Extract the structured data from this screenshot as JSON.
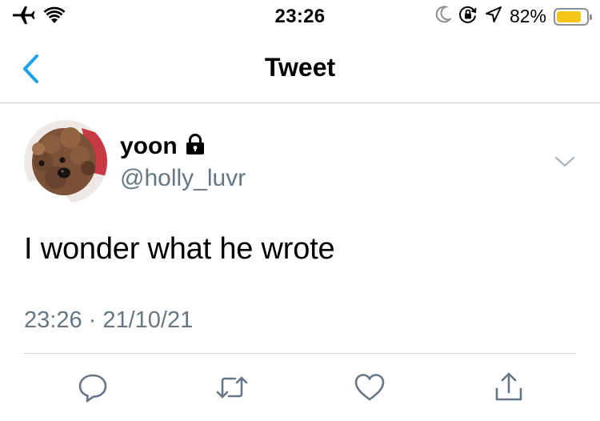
{
  "status_bar": {
    "time": "23:26",
    "battery_percent": "82%",
    "battery_level": 0.82,
    "battery_color": "#f5c71a",
    "icons": [
      "airplane-icon",
      "wifi-icon",
      "moon-icon",
      "orientation-lock-icon",
      "location-icon",
      "battery-icon"
    ]
  },
  "nav": {
    "title": "Tweet",
    "back_icon": "chevron-left-icon",
    "accent_color": "#1da1f2"
  },
  "tweet": {
    "author_name": "yoon",
    "protected_icon": "lock-icon",
    "author_handle": "@holly_luvr",
    "text": "I wonder what he wrote",
    "timestamp": "23:26 · 21/10/21",
    "more_icon": "chevron-down-icon"
  },
  "actions": [
    {
      "name": "reply",
      "icon": "reply-icon"
    },
    {
      "name": "retweet",
      "icon": "retweet-icon"
    },
    {
      "name": "like",
      "icon": "heart-icon"
    },
    {
      "name": "share",
      "icon": "share-icon"
    }
  ],
  "colors": {
    "secondary_text": "#657786",
    "divider": "#d6d6da"
  }
}
